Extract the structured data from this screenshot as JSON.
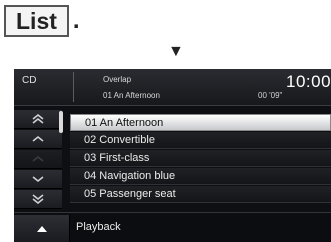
{
  "instruction": {
    "key_label": "List",
    "suffix": "."
  },
  "header": {
    "source": "CD",
    "album": "Overlap",
    "now_playing": "01  An Afternoon",
    "elapsed": "00 '09\"",
    "clock": "10:00"
  },
  "tracks": [
    {
      "label": "01 An Afternoon"
    },
    {
      "label": "02 Convertible"
    },
    {
      "label": "03 First-class"
    },
    {
      "label": "04 Navigation blue"
    },
    {
      "label": "05 Passenger seat"
    }
  ],
  "bottom": {
    "playback_label": "Playback"
  },
  "icons": {
    "arrow": "down-triangle-icon",
    "page_up": "double-chevron-up-icon",
    "line_up": "chevron-up-icon",
    "center": "disabled-icon",
    "line_down": "chevron-down-icon",
    "page_down": "double-chevron-down-icon",
    "up": "triangle-up-icon"
  }
}
